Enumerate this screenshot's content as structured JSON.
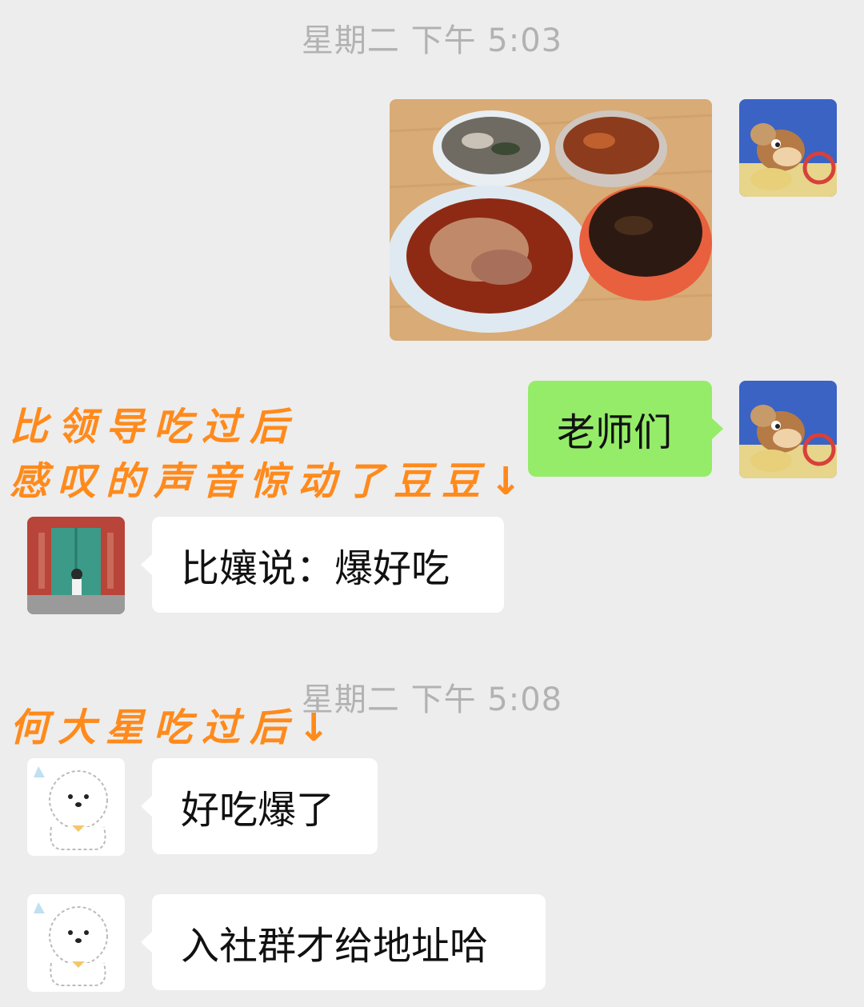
{
  "timestamps": [
    "星期二 下午 5:03",
    "星期二 下午 5:08"
  ],
  "captions": {
    "first_line1": "比领导吃过后",
    "first_line2": "感叹的声音惊动了豆豆↓",
    "second": "何大星吃过后↓"
  },
  "messages": {
    "teachers": "老师们",
    "bixiang": "比孃说：爆好吃",
    "delicious": "好吃爆了",
    "join_group": "入社群才给地址哈"
  },
  "icons": {
    "sender_avatar": "cartoon-mouse-avatar",
    "girl_avatar": "girl-at-green-door-avatar",
    "dog_avatar": "white-dog-avatar",
    "food_photo": "food-dishes-photo"
  },
  "colors": {
    "background": "#ededed",
    "sent_bubble": "#95ec69",
    "received_bubble": "#ffffff",
    "caption": "#ff8a1c",
    "timestamp": "#b2b2b2"
  }
}
